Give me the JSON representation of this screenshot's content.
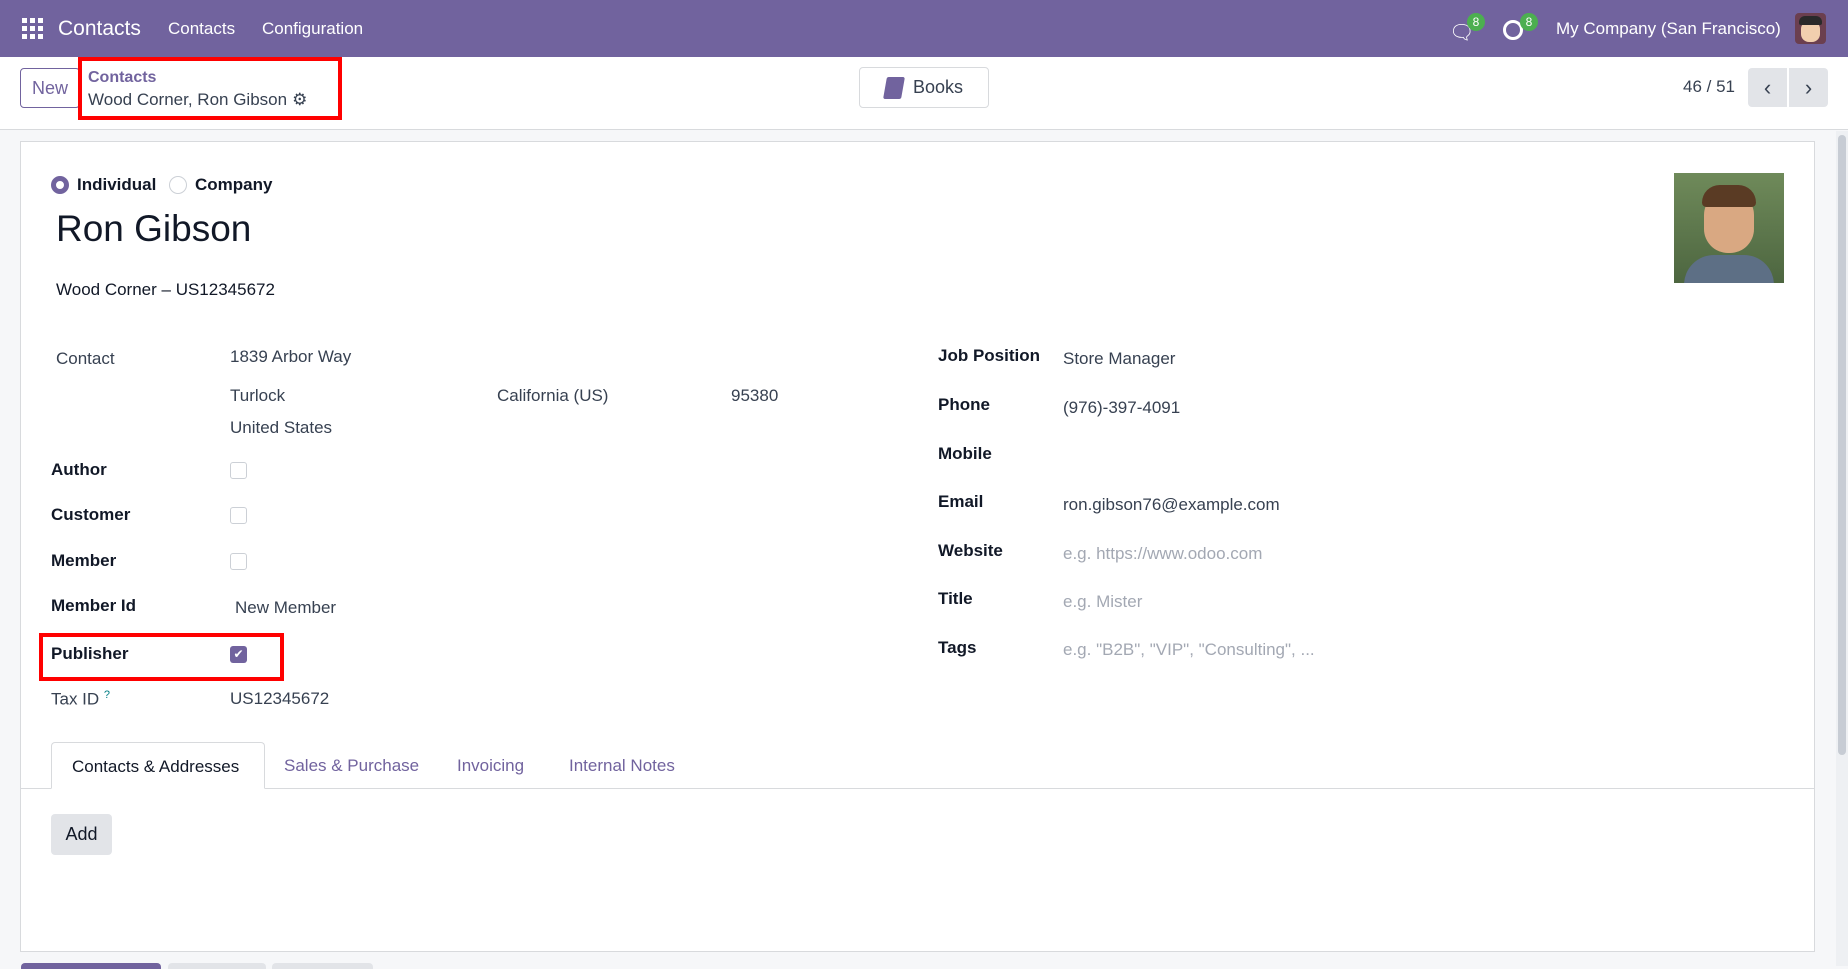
{
  "navbar": {
    "app_name": "Contacts",
    "menu": [
      "Contacts",
      "Configuration"
    ],
    "messages_count": "8",
    "activities_count": "8",
    "company": "My Company (San Francisco)",
    "accent_color": "#71639e"
  },
  "control_panel": {
    "new_label": "New",
    "breadcrumb_parent": "Contacts",
    "breadcrumb_current": "Wood Corner, Ron Gibson",
    "books_label": "Books",
    "pager": "46 / 51"
  },
  "form": {
    "type_options": [
      {
        "label": "Individual",
        "selected": true
      },
      {
        "label": "Company",
        "selected": false
      }
    ],
    "name": "Ron Gibson",
    "company_line": "Wood Corner – US12345672",
    "contact_label": "Contact",
    "street": "1839 Arbor Way",
    "city": "Turlock",
    "state": "California (US)",
    "zip": "95380",
    "country": "United States",
    "author_label": "Author",
    "author_checked": false,
    "customer_label": "Customer",
    "customer_checked": false,
    "member_label": "Member",
    "member_checked": false,
    "member_id_label": "Member Id",
    "member_id_value": "New Member",
    "publisher_label": "Publisher",
    "publisher_checked": true,
    "tax_id_label": "Tax ID",
    "tax_id_help": "?",
    "tax_id_value": "US12345672",
    "right_fields": [
      {
        "label": "Job Position",
        "value": "Store Manager",
        "placeholder": false
      },
      {
        "label": "Phone",
        "value": "(976)-397-4091",
        "placeholder": false
      },
      {
        "label": "Mobile",
        "value": "",
        "placeholder": false
      },
      {
        "label": "Email",
        "value": "ron.gibson76@example.com",
        "placeholder": false
      },
      {
        "label": "Website",
        "value": "e.g. https://www.odoo.com",
        "placeholder": true
      },
      {
        "label": "Title",
        "value": "e.g. Mister",
        "placeholder": true
      },
      {
        "label": "Tags",
        "value": "e.g. \"B2B\", \"VIP\", \"Consulting\", ...",
        "placeholder": true
      }
    ]
  },
  "tabs": [
    {
      "label": "Contacts & Addresses",
      "active": true
    },
    {
      "label": "Sales & Purchase",
      "active": false
    },
    {
      "label": "Invoicing",
      "active": false
    },
    {
      "label": "Internal Notes",
      "active": false
    }
  ],
  "add_label": "Add"
}
